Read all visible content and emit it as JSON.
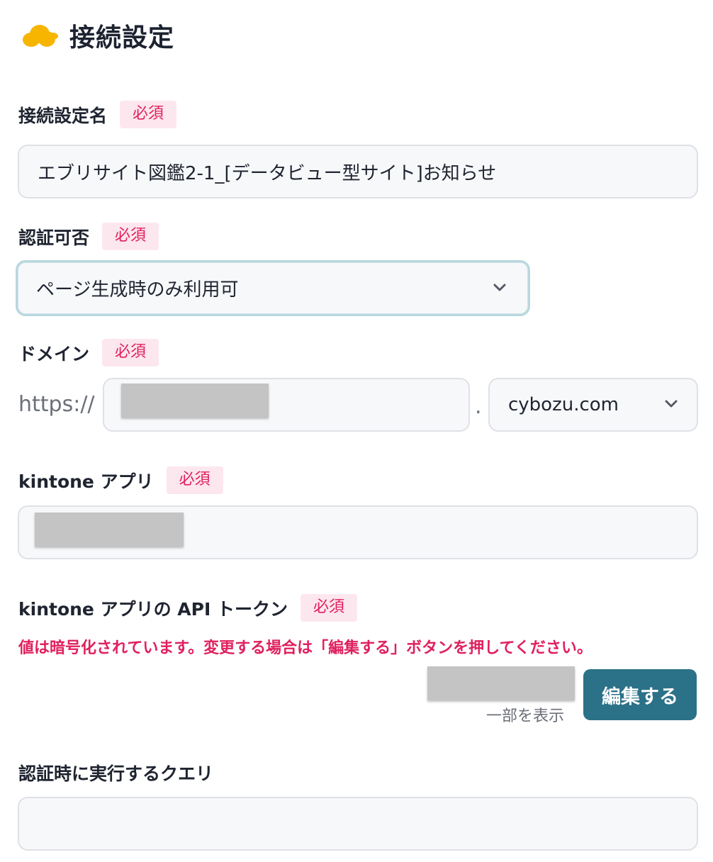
{
  "header": {
    "title": "接続設定",
    "icon": "cloud-icon"
  },
  "colors": {
    "accent": "#2b7188",
    "required": "#e0205e",
    "cloud": "#f7b500"
  },
  "connection_name": {
    "label": "接続設定名",
    "required_badge": "必須",
    "value": "エブリサイト図鑑2-1_[データビュー型サイト]お知らせ"
  },
  "auth": {
    "label": "認証可否",
    "required_badge": "必須",
    "selected": "ページ生成時のみ利用可"
  },
  "domain": {
    "label": "ドメイン",
    "required_badge": "必須",
    "prefix": "https://",
    "separator": ".",
    "suffix_selected": "cybozu.com"
  },
  "kintone_app": {
    "label": "kintone アプリ",
    "required_badge": "必須"
  },
  "api_token": {
    "label": "kintone アプリの API トークン",
    "required_badge": "必須",
    "notice": "値は暗号化されています。変更する場合は「編集する」ボタンを押してください。",
    "partial_hint": "一部を表示",
    "edit_label": "編集する"
  },
  "query": {
    "label": "認証時に実行するクエリ",
    "value": ""
  }
}
